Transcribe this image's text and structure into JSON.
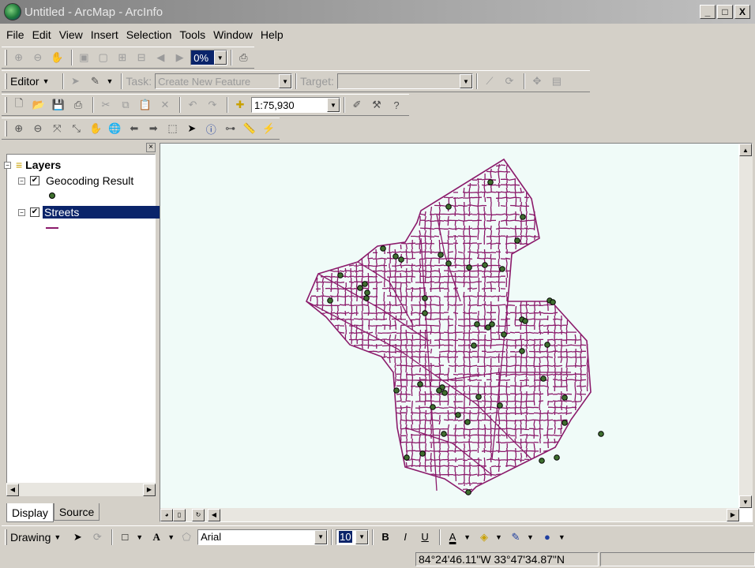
{
  "window": {
    "title": "Untitled - ArcMap - ArcInfo",
    "minimize": "_",
    "maximize": "□",
    "close": "X"
  },
  "menu": [
    {
      "label": "File"
    },
    {
      "label": "Edit"
    },
    {
      "label": "View"
    },
    {
      "label": "Insert"
    },
    {
      "label": "Selection"
    },
    {
      "label": "Tools"
    },
    {
      "label": "Window"
    },
    {
      "label": "Help"
    }
  ],
  "layout_toolbar": {
    "zoom_percent": "0%"
  },
  "editor_toolbar": {
    "editor_label": "Editor",
    "task_label": "Task:",
    "task_value": "Create New Feature",
    "target_label": "Target:",
    "target_value": ""
  },
  "standard_toolbar": {
    "scale": "1:75,930"
  },
  "toc": {
    "root": "Layers",
    "layers": [
      {
        "name": "Geocoding Result",
        "checked": true,
        "symbol": "point"
      },
      {
        "name": "Streets",
        "checked": true,
        "symbol": "line",
        "selected": true
      }
    ],
    "tabs": [
      "Display",
      "Source"
    ]
  },
  "drawing_toolbar": {
    "drawing_label": "Drawing",
    "font": "Arial",
    "font_size": "10",
    "bold": "B",
    "italic": "I",
    "underline": "U"
  },
  "status": {
    "coordinates": "84°24'46.11\"W  33°47'34.87\"N"
  },
  "colors": {
    "streets": "#8b1a6b",
    "points": "#3f6f2f",
    "map_background": "#f0fbf8",
    "selection": "#0a246a"
  }
}
